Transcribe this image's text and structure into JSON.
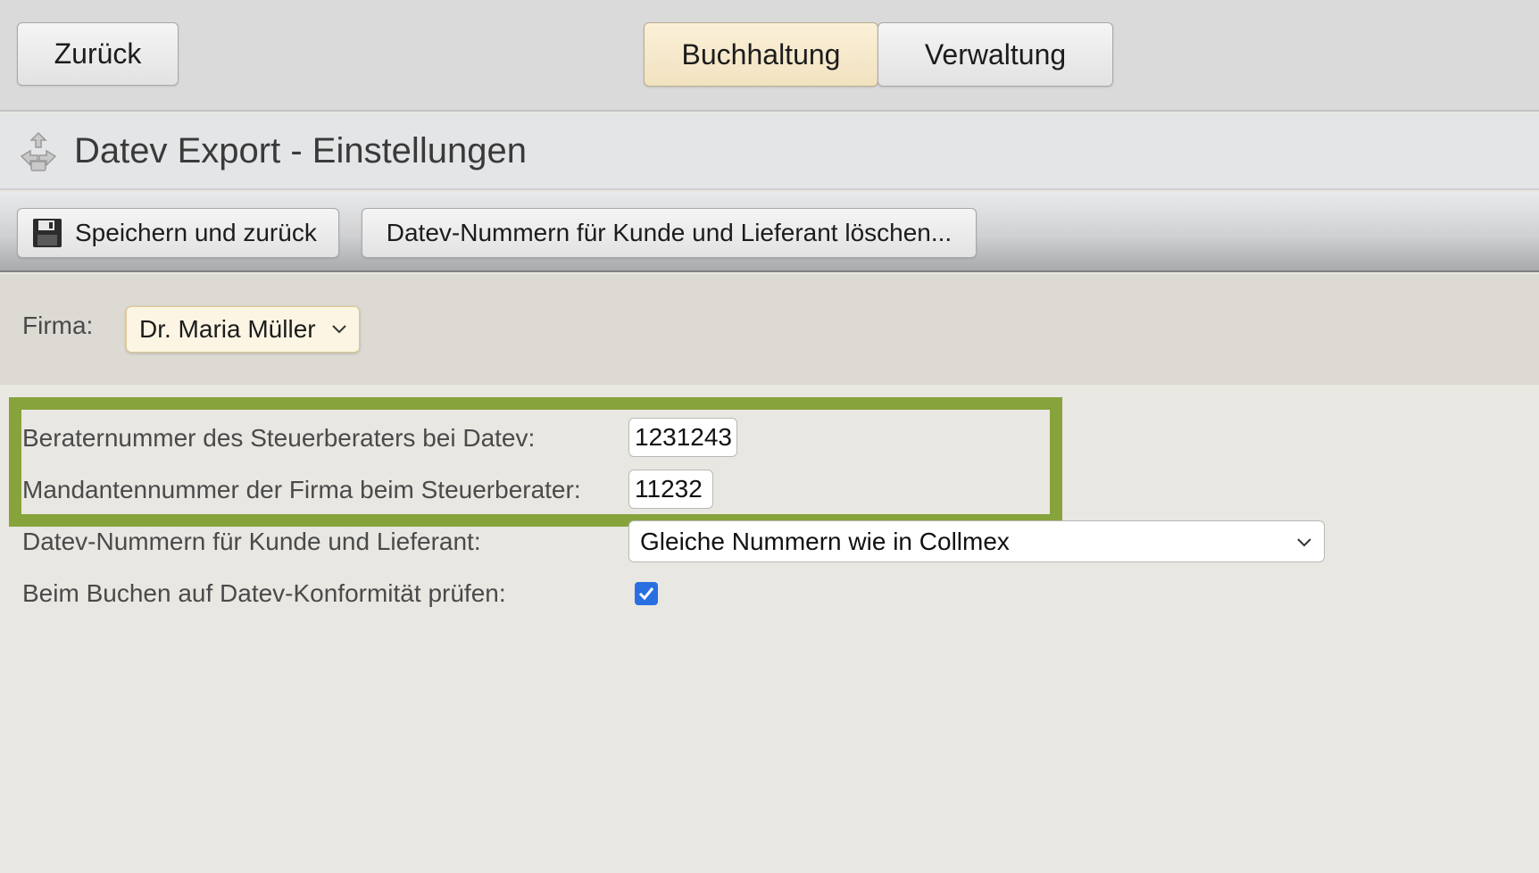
{
  "topbar": {
    "back_label": "Zurück",
    "tabs": [
      {
        "label": "Buchhaltung",
        "active": true
      },
      {
        "label": "Verwaltung",
        "active": false
      }
    ]
  },
  "page": {
    "title": "Datev Export - Einstellungen"
  },
  "toolbar": {
    "save_label": "Speichern und zurück",
    "delete_label": "Datev-Nummern für Kunde und Lieferant löschen..."
  },
  "firma": {
    "label": "Firma:",
    "selected": "Dr. Maria Müller"
  },
  "form": {
    "berater_label": "Beraternummer des Steuerberaters bei Datev:",
    "berater_value": "1231243",
    "mandant_label": "Mandantennummer der Firma beim Steuerberater:",
    "mandant_value": "11232",
    "nummern_label": "Datev-Nummern für Kunde und Lieferant:",
    "nummern_selected": "Gleiche Nummern wie in Collmex",
    "pruefen_label": "Beim Buchen auf Datev-Konformität prüfen:",
    "pruefen_checked": true
  },
  "colors": {
    "highlight": "#87a33b",
    "active_tab": "#f1e2c0",
    "checkbox": "#2a6fe0"
  },
  "icons": [
    "settings-puzzle-icon",
    "floppy-disk-icon",
    "chevron-down-icon",
    "checkmark-icon"
  ]
}
